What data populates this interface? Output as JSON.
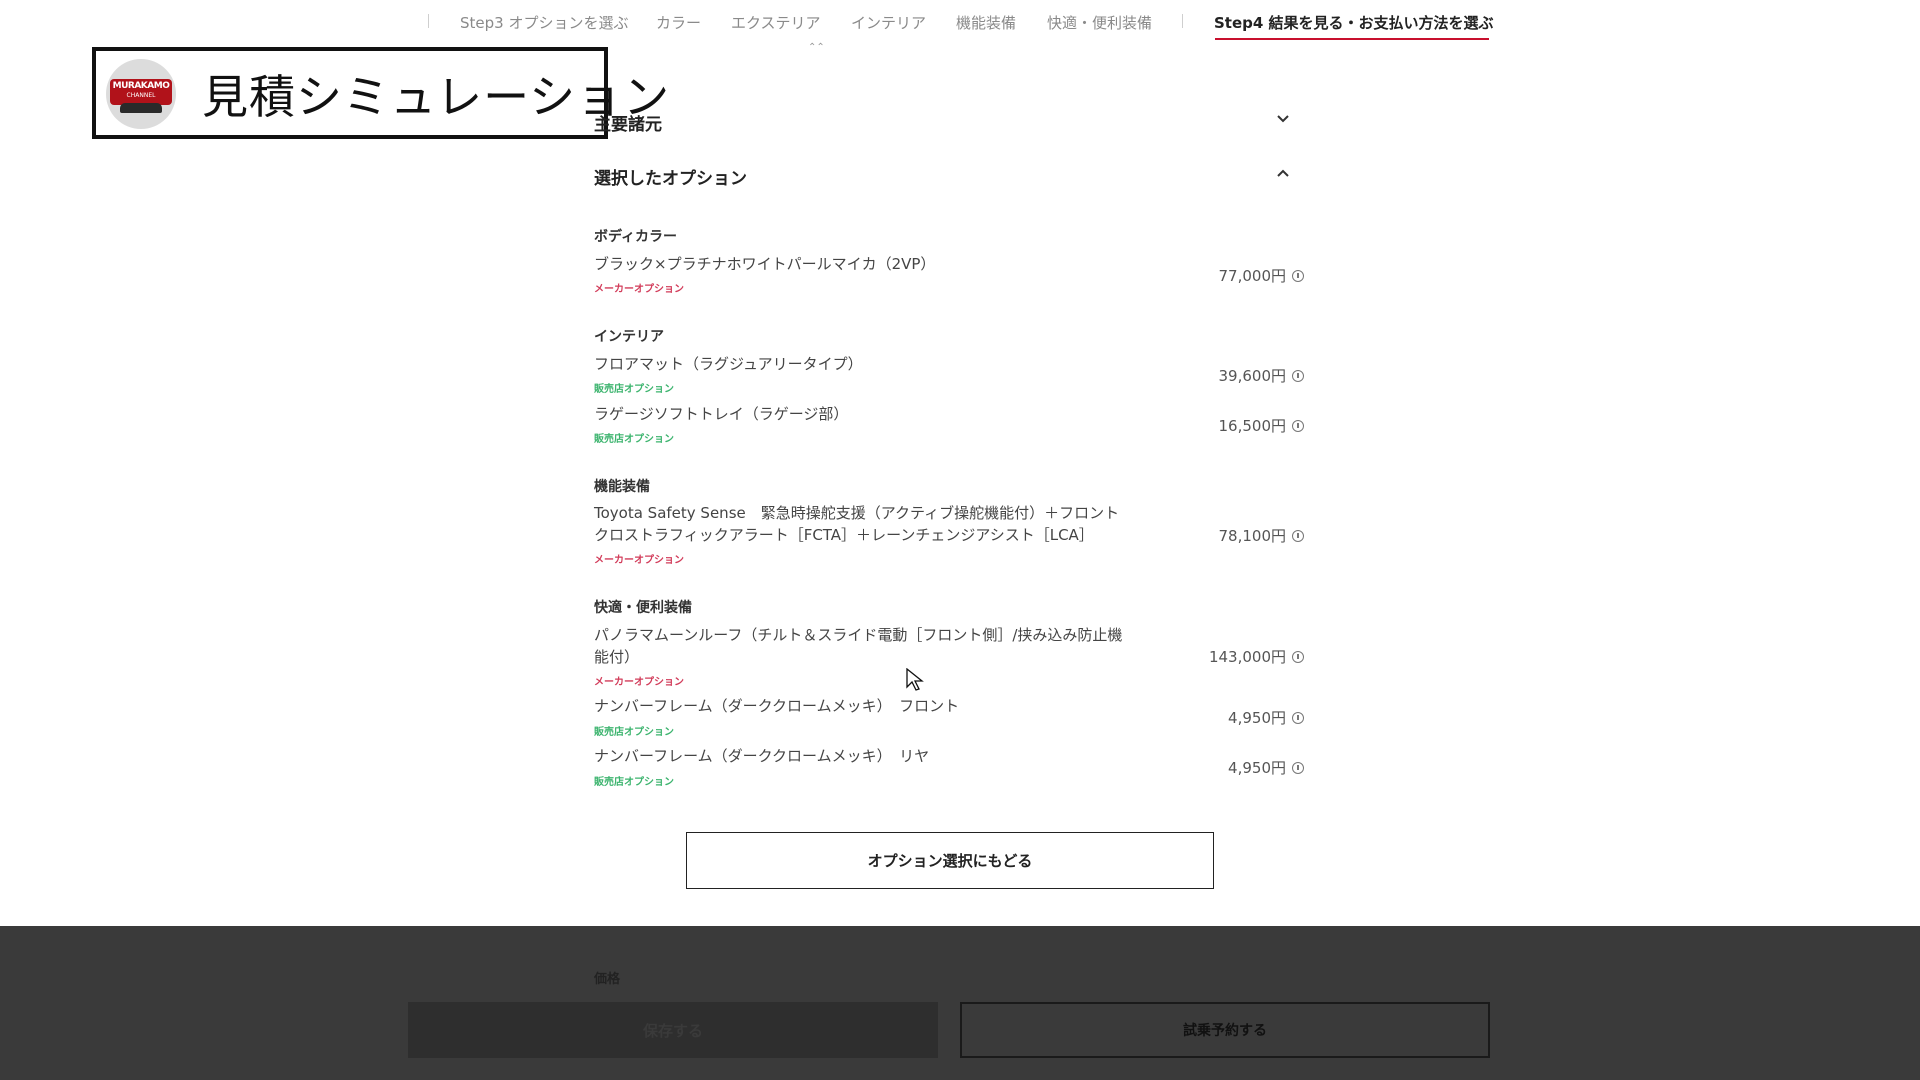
{
  "step_nav": {
    "items": [
      {
        "label": "Step3 オプションを選ぶ",
        "active": false
      },
      {
        "label": "カラー",
        "active": false
      },
      {
        "label": "エクステリア",
        "active": false
      },
      {
        "label": "インテリア",
        "active": false
      },
      {
        "label": "機能装備",
        "active": false
      },
      {
        "label": "快適・便利装備",
        "active": false
      },
      {
        "label": "Step4 結果を見る・お支払い方法を選ぶ",
        "active": true
      }
    ],
    "accent_color": "#c8102e"
  },
  "overlay": {
    "title": "見積シミュレーション",
    "logo_text": "MURAKAMO",
    "logo_sub": "CHANNEL"
  },
  "sections": {
    "specs": {
      "label": "主要諸元",
      "expanded": false,
      "icon": "chevron-down-icon"
    },
    "options": {
      "label": "選択したオプション",
      "expanded": true,
      "icon": "chevron-up-icon"
    }
  },
  "option_groups": [
    {
      "category": "ボディカラー",
      "items": [
        {
          "name": "ブラック×プラチナホワイトパールマイカ（2VP）",
          "tag": "メーカーオプション",
          "tag_type": "maker",
          "price": "77,000円"
        }
      ]
    },
    {
      "category": "インテリア",
      "items": [
        {
          "name": "フロアマット（ラグジュアリータイプ）",
          "tag": "販売店オプション",
          "tag_type": "dealer",
          "price": "39,600円"
        },
        {
          "name": "ラゲージソフトトレイ（ラゲージ部）",
          "tag": "販売店オプション",
          "tag_type": "dealer",
          "price": "16,500円"
        }
      ]
    },
    {
      "category": "機能装備",
      "items": [
        {
          "name": "Toyota Safety Sense　緊急時操舵支援（アクティブ操舵機能付）＋フロントクロストラフィックアラート［FCTA］＋レーンチェンジアシスト［LCA］",
          "tag": "メーカーオプション",
          "tag_type": "maker",
          "price": "78,100円"
        }
      ]
    },
    {
      "category": "快適・便利装備",
      "items": [
        {
          "name": "パノラマムーンルーフ（チルト＆スライド電動［フロント側］/挟み込み防止機能付）",
          "tag": "メーカーオプション",
          "tag_type": "maker",
          "price": "143,000円"
        },
        {
          "name": "ナンバーフレーム（ダーククロームメッキ）　フロント",
          "tag": "販売店オプション",
          "tag_type": "dealer",
          "price": "4,950円"
        },
        {
          "name": "ナンバーフレーム（ダーククロームメッキ）　リヤ",
          "tag": "販売店オプション",
          "tag_type": "dealer",
          "price": "4,950円"
        }
      ]
    }
  ],
  "back_button": {
    "label": "オプション選択にもどる"
  },
  "bottom_bar": {
    "price_label": "価格",
    "save_label": "保存する",
    "test_drive_label": "試乗予約する",
    "bg_color": "#3a3a3a"
  },
  "colors": {
    "maker_tag": "#d23c5a",
    "dealer_tag": "#3cb46e"
  }
}
